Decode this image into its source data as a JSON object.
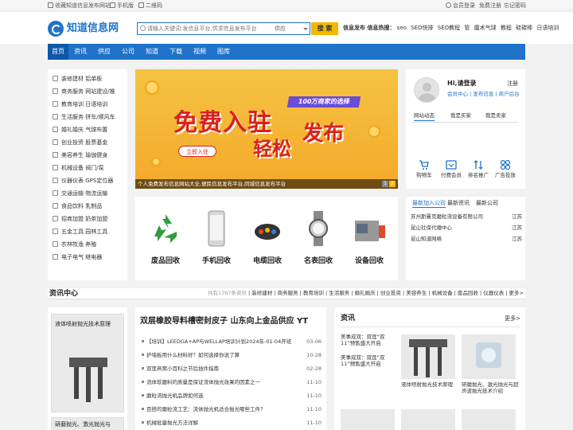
{
  "topbar": {
    "bookmark": "收藏知道信息发布网站",
    "mobile": "手机版",
    "qrcode": "二维码",
    "login": "会员登录",
    "register": "免费注册",
    "forgot": "忘记密码"
  },
  "header": {
    "logo": "知道信息网",
    "search_placeholder": "请输入关键词:发信息平台,供求信息发布平台",
    "search_scope": "供应",
    "search_button": "搜 索",
    "hot_label": "信息发布 信息热搜：",
    "hot_terms": [
      "seo",
      "SEO快排",
      "SEO教程",
      "管",
      "魔术气球",
      "教程",
      "硅碳棒",
      "日语培训"
    ]
  },
  "nav": [
    "首页",
    "资讯",
    "供应",
    "公司",
    "知道",
    "下载",
    "视频",
    "图库"
  ],
  "categories": [
    "装修建材 铝单板",
    "商务服务 网站建设/推",
    "教育培训 日语培训",
    "生活服务 拼车/顺风车",
    "婚礼婚庆 气球布置",
    "创业投资 股票基金",
    "美容养生 瑜伽健身",
    "机械设备 阀门/泵",
    "仪器仪表 GPS定位器",
    "交通运输 物流运输",
    "食品饮料 乳制品",
    "招商加盟 奶茶加盟",
    "五金工具 园林工具",
    "农林牧渔 养殖",
    "电子电气 继电器"
  ],
  "banner": {
    "ribbon": "100万商家的选择",
    "headline1": "免费入驻",
    "headline2": "轻松",
    "headline3": "发布",
    "cta": "立即入驻",
    "caption": "个人免费发布信息网站大全,便民信息发布平台,同城信息发布平台",
    "pages": [
      "1",
      "2"
    ]
  },
  "recycle": [
    "废品回收",
    "手机回收",
    "电缆回收",
    "名表回收",
    "设备回收"
  ],
  "userbox": {
    "hello": "Hi,请登录",
    "register": "注册",
    "links": "会员中心 | 发布信息 | 商户后台",
    "tabs": [
      "网站动态",
      "我是买家",
      "我是卖家"
    ],
    "icons": [
      "购物车",
      "付费会员",
      "排名推广",
      "广告投放"
    ]
  },
  "companies": {
    "tabs": [
      "最新加入公司",
      "最新资讯",
      "最新公司"
    ],
    "rows": [
      {
        "name": "苏州斯曼克磨粒流设备有限公司",
        "region": "江苏"
      },
      {
        "name": "昆山社保代缴中心",
        "region": "江苏"
      },
      {
        "name": "昆山知道网络",
        "region": "江苏"
      }
    ]
  },
  "news": {
    "title": "资讯中心",
    "count": "共有1767条资讯",
    "cats": [
      "装修建材",
      "商务服务",
      "教育培训",
      "生活服务",
      "婚礼婚庆",
      "创业投资",
      "美容养生",
      "机械设备",
      "废品回收",
      "仪器仪表",
      "更多>"
    ],
    "left_cards": [
      "液体喷射抛光技术原理",
      "研磨抛光、激光抛光与"
    ],
    "headline": "双层橡胶导料槽密封皮子 山东向上金品供应 YT",
    "items": [
      {
        "title": "【培训】LEEDGA+AP与WELLAP培训计划2024年-01-04开班",
        "date": "03-06"
      },
      {
        "title": "护墙板用什么材料好？如何选择你说了算",
        "date": "10-28"
      },
      {
        "title": "双莲燕窝小百科之节后插件指南",
        "date": "02-28"
      },
      {
        "title": "流体软磨料的质量是保证流体抛光效果的因素之一",
        "date": "11-10"
      },
      {
        "title": "磨粒流抛光机品牌如何选",
        "date": "11-10"
      },
      {
        "title": "百搭的磨粒流工艺：流体抛光机适合抛光哪些工件？",
        "date": "11-10"
      },
      {
        "title": "机械批量抛光方法详解",
        "date": "11-10"
      }
    ]
  },
  "pictures": {
    "title": "资讯",
    "more": "更多>",
    "side_text": [
      "美事成双：双莲“双11”预售盛大开启",
      "美事成双：双莲“双11”预售盛大开启"
    ],
    "cards": [
      "液体喷射抛光技术原理",
      "研磨抛光、激光抛光与超声波抛光技术介绍"
    ]
  },
  "colors": {
    "brand": "#1f73c9",
    "accent": "#f5b800",
    "banner_red": "#d9211d"
  }
}
